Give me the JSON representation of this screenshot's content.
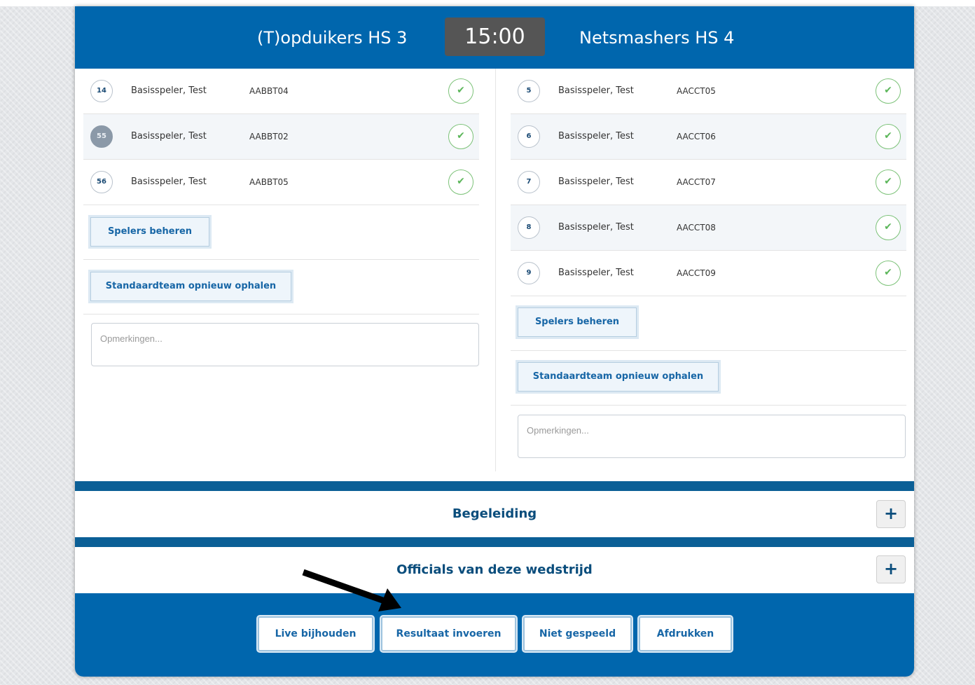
{
  "match": {
    "home_team": "(T)opduikers HS 3",
    "away_team": "Netsmashers HS 4",
    "time": "15:00"
  },
  "home": {
    "players": [
      {
        "number": "14",
        "name": "Basisspeler, Test",
        "code": "AABBT04",
        "highlight": false
      },
      {
        "number": "55",
        "name": "Basisspeler, Test",
        "code": "AABBT02",
        "highlight": true
      },
      {
        "number": "56",
        "name": "Basisspeler, Test",
        "code": "AABBT05",
        "highlight": false
      }
    ],
    "manage_players_label": "Spelers beheren",
    "refresh_team_label": "Standaardteam opnieuw ophalen",
    "remarks_placeholder": "Opmerkingen..."
  },
  "away": {
    "players": [
      {
        "number": "5",
        "name": "Basisspeler, Test",
        "code": "AACCT05"
      },
      {
        "number": "6",
        "name": "Basisspeler, Test",
        "code": "AACCT06"
      },
      {
        "number": "7",
        "name": "Basisspeler, Test",
        "code": "AACCT07"
      },
      {
        "number": "8",
        "name": "Basisspeler, Test",
        "code": "AACCT08"
      },
      {
        "number": "9",
        "name": "Basisspeler, Test",
        "code": "AACCT09"
      }
    ],
    "manage_players_label": "Spelers beheren",
    "refresh_team_label": "Standaardteam opnieuw ophalen",
    "remarks_placeholder": "Opmerkingen..."
  },
  "sections": {
    "guidance": "Begeleiding",
    "officials": "Officials van deze wedstrijd",
    "expand_symbol": "+"
  },
  "footer": {
    "live": "Live bijhouden",
    "result": "Resultaat invoeren",
    "not_played": "Niet gespeeld",
    "print": "Afdrukken"
  },
  "icons": {
    "check": "checkmark-icon",
    "arrow": "annotation-arrow"
  },
  "colors": {
    "brand_blue": "#0066ad",
    "check_green": "#5cb65a"
  }
}
